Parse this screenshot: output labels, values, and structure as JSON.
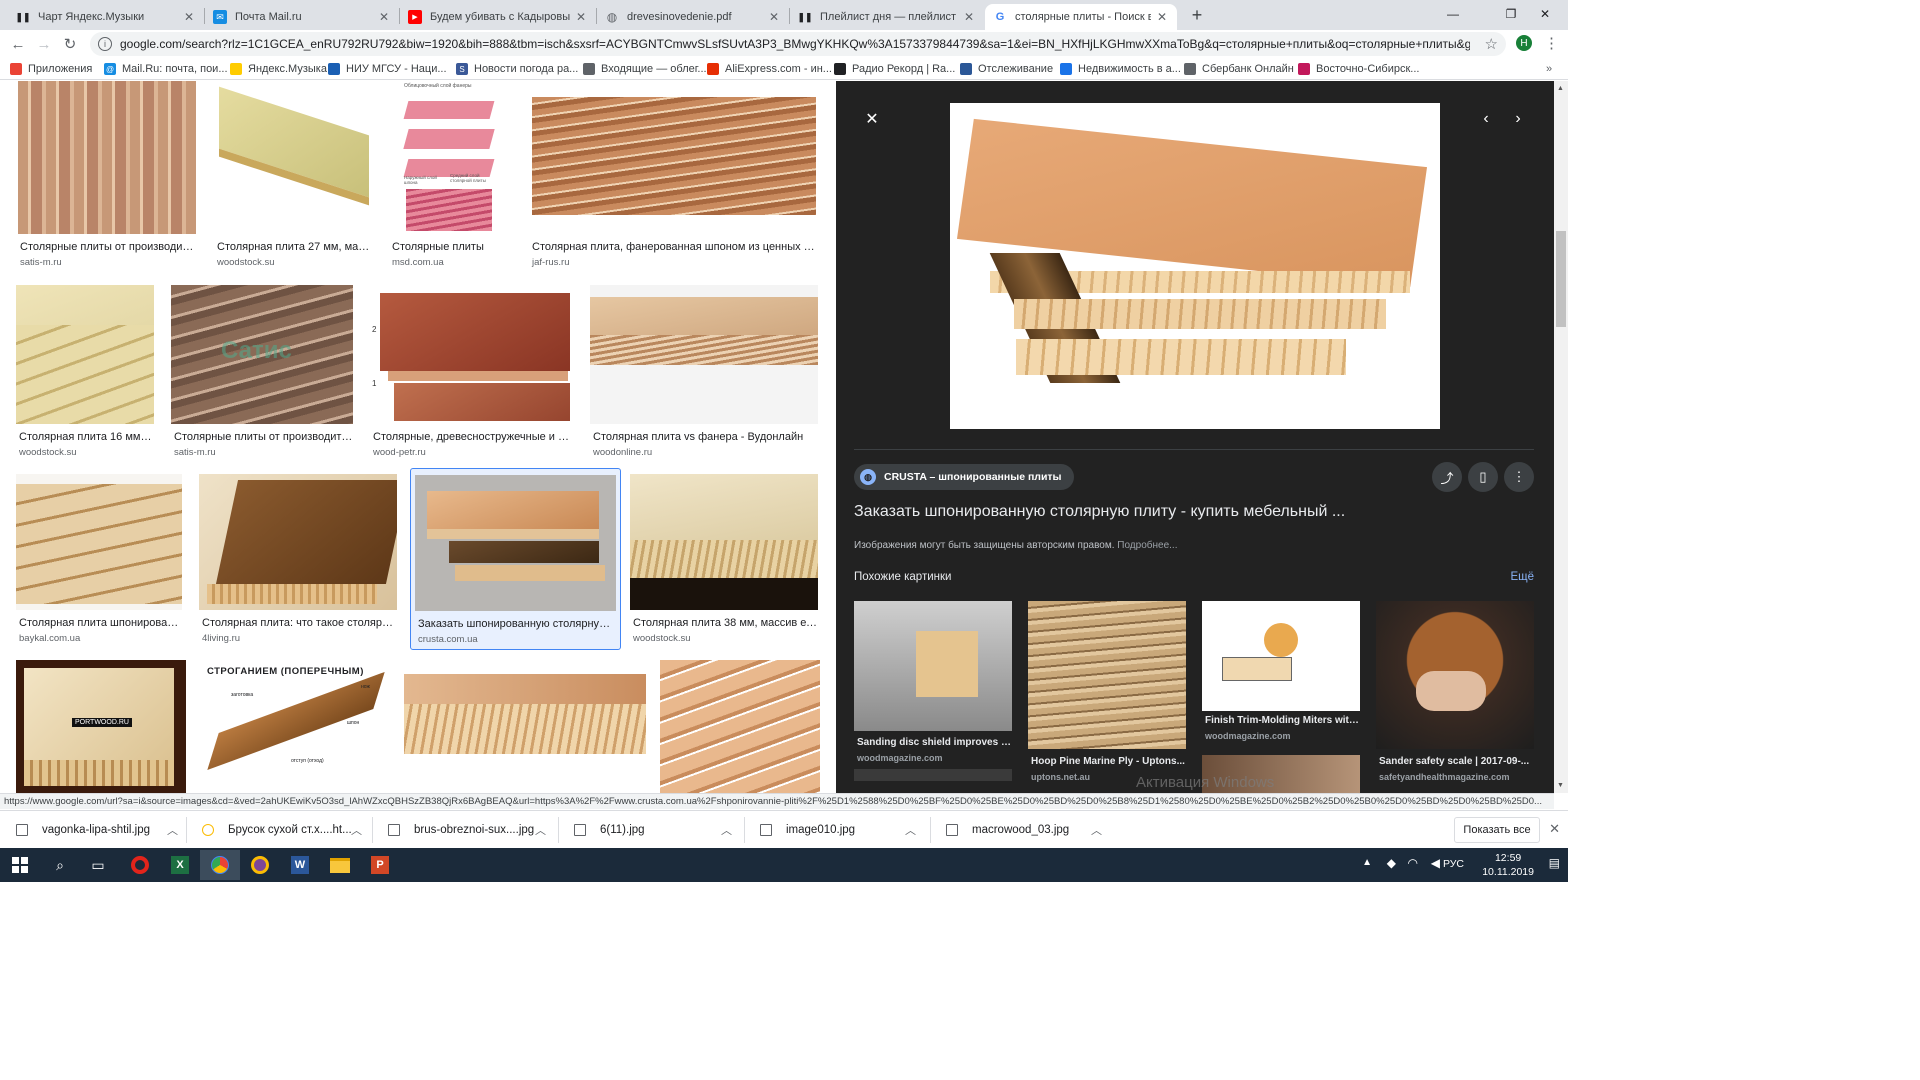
{
  "browser": {
    "tabs": [
      {
        "title": "Чарт Яндекс.Музыки",
        "icon": "pause-icon"
      },
      {
        "title": "Почта Mail.ru",
        "icon": "mail-icon"
      },
      {
        "title": "Будем убивать с Кадыровым. Ра",
        "icon": "youtube-icon"
      },
      {
        "title": "drevesinovedenie.pdf",
        "icon": "globe-icon"
      },
      {
        "title": "Плейлист дня — плейлист на Ян",
        "icon": "pause-icon"
      },
      {
        "title": "столярные плиты - Поиск в Goo",
        "icon": "google-icon",
        "active": true
      }
    ],
    "new_tab": "+",
    "url": "google.com/search?rlz=1C1GCEA_enRU792RU792&biw=1920&bih=888&tbm=isch&sxsrf=ACYBGNTCmwvSLsfSUvtA3P3_BMwgYKHKQw%3A1573379844739&sa=1&ei=BN_HXfHjLKGHmwXXmaToBg&q=столярные+плиты&oq=столярные+плиты&gs_l=img.3..0.175...",
    "profile_letter": "Н",
    "bookmarks": [
      {
        "label": "Приложения",
        "color": "#ea4335"
      },
      {
        "label": "Mail.Ru: почта, пои...",
        "color": "#168de2"
      },
      {
        "label": "Яндекс.Музыка",
        "color": "#ffcc00"
      },
      {
        "label": "НИУ МГСУ - Наци...",
        "color": "#1a5fb4"
      },
      {
        "label": "Новости погода ра...",
        "color": "#3b5998"
      },
      {
        "label": "Входящие — облег...",
        "color": "#5f6368"
      },
      {
        "label": "AliExpress.com - ин...",
        "color": "#e62e04"
      },
      {
        "label": "Радио Рекорд | Ra...",
        "color": "#202124"
      },
      {
        "label": "Отслеживание",
        "color": "#2b5797"
      },
      {
        "label": "Недвижимость в а...",
        "color": "#1a73e8"
      },
      {
        "label": "Сбербанк Онлайн",
        "color": "#5f6368"
      },
      {
        "label": "Восточно-Сибирск...",
        "color": "#c2185b"
      }
    ]
  },
  "results": [
    {
      "caption": "Столярные плиты от производител...",
      "source": "satis-m.ru"
    },
    {
      "caption": "Столярная плита 27 мм, масс...",
      "source": "woodstock.su"
    },
    {
      "caption": "Столярные плиты",
      "source": "msd.com.ua"
    },
    {
      "caption": "Столярная плита, фанерованная шпоном из ценных поро...",
      "source": "jaf-rus.ru"
    },
    {
      "caption": "Столярная плита 16 мм, ...",
      "source": "woodstock.su"
    },
    {
      "caption": "Столярные плиты от производител...",
      "source": "satis-m.ru"
    },
    {
      "caption": "Столярные, древесностружечные и дре...",
      "source": "wood-petr.ru"
    },
    {
      "caption": "Столярная плита vs фанера - Вудонлайн",
      "source": "woodonline.ru"
    },
    {
      "caption": "Столярная плита шпонированн...",
      "source": "baykal.com.ua"
    },
    {
      "caption": "Столярная плита: что такое столярная...",
      "source": "4living.ru"
    },
    {
      "caption": "Заказать шпонированную столярную п...",
      "source": "crusta.com.ua"
    },
    {
      "caption": "Столярная плита 38 мм, массив ели...",
      "source": "woodstock.su"
    },
    {
      "caption": "",
      "source": ""
    },
    {
      "caption": "",
      "source": ""
    },
    {
      "caption": "",
      "source": ""
    },
    {
      "caption": "",
      "source": ""
    }
  ],
  "image_text": {
    "diagram_label_a": "Облицовочный слой фанеры",
    "diagram_label_b": "Наружный слой шпона",
    "diagram_label_c": "Средний слой столярной плиты",
    "planing_title": "СТРОГАНИЕМ (ПОПЕРЕЧНЫМ)",
    "planing_l1": "заготовка",
    "planing_l2": "нож",
    "planing_l3": "шпон",
    "planing_l4": "отступ (отход)",
    "portwood": "PORTWOOD.RU",
    "satis_watermark": "Сатис",
    "num1": "1",
    "num2": "2"
  },
  "panel": {
    "source_chip": "CRUSTA – шпонированные плиты",
    "title": "Заказать шпонированную столярную плиту - купить мебельный ...",
    "copyright": "Изображения могут быть защищены авторским правом.",
    "more_link": "Подробнее...",
    "similar_heading": "Похожие картинки",
    "all_link": "Ещё",
    "similar": [
      {
        "caption": "Sanding disc shield improves s...",
        "source": "woodmagazine.com"
      },
      {
        "caption": "Hoop Pine Marine Ply - Uptons...",
        "source": "uptons.net.au"
      },
      {
        "caption": "Finish Trim-Molding Miters with...",
        "source": "woodmagazine.com"
      },
      {
        "caption": "Sander safety scale | 2017-09-...",
        "source": "safetyandhealthmagazine.com"
      }
    ],
    "watermark": "Активация Windows"
  },
  "status_url": "https://www.google.com/url?sa=i&source=images&cd=&ved=2ahUKEwiKv5O3sd_lAhWZxcQBHSzZB38QjRx6BAgBEAQ&url=https%3A%2F%2Fwww.crusta.com.ua%2Fshponirovannie-pliti%2F%25D1%2588%25D0%25BF%25D0%25BE%25D0%25BD%25D0%25B8%25D1%2580%25D0%25BE%25D0%25B2%25D0%25B0%25D0%25BD%25D0%25BD%25D0...",
  "downloads": [
    {
      "name": "vagonka-lipa-shtil.jpg"
    },
    {
      "name": "Брусок сухой ст.х....ht..."
    },
    {
      "name": "brus-obreznoi-sux....jpg"
    },
    {
      "name": "6(11).jpg"
    },
    {
      "name": "image010.jpg"
    },
    {
      "name": "macrowood_03.jpg"
    }
  ],
  "show_all": "Показать все",
  "taskbar": {
    "lang": "РУС",
    "time": "12:59",
    "date": "10.11.2019"
  }
}
